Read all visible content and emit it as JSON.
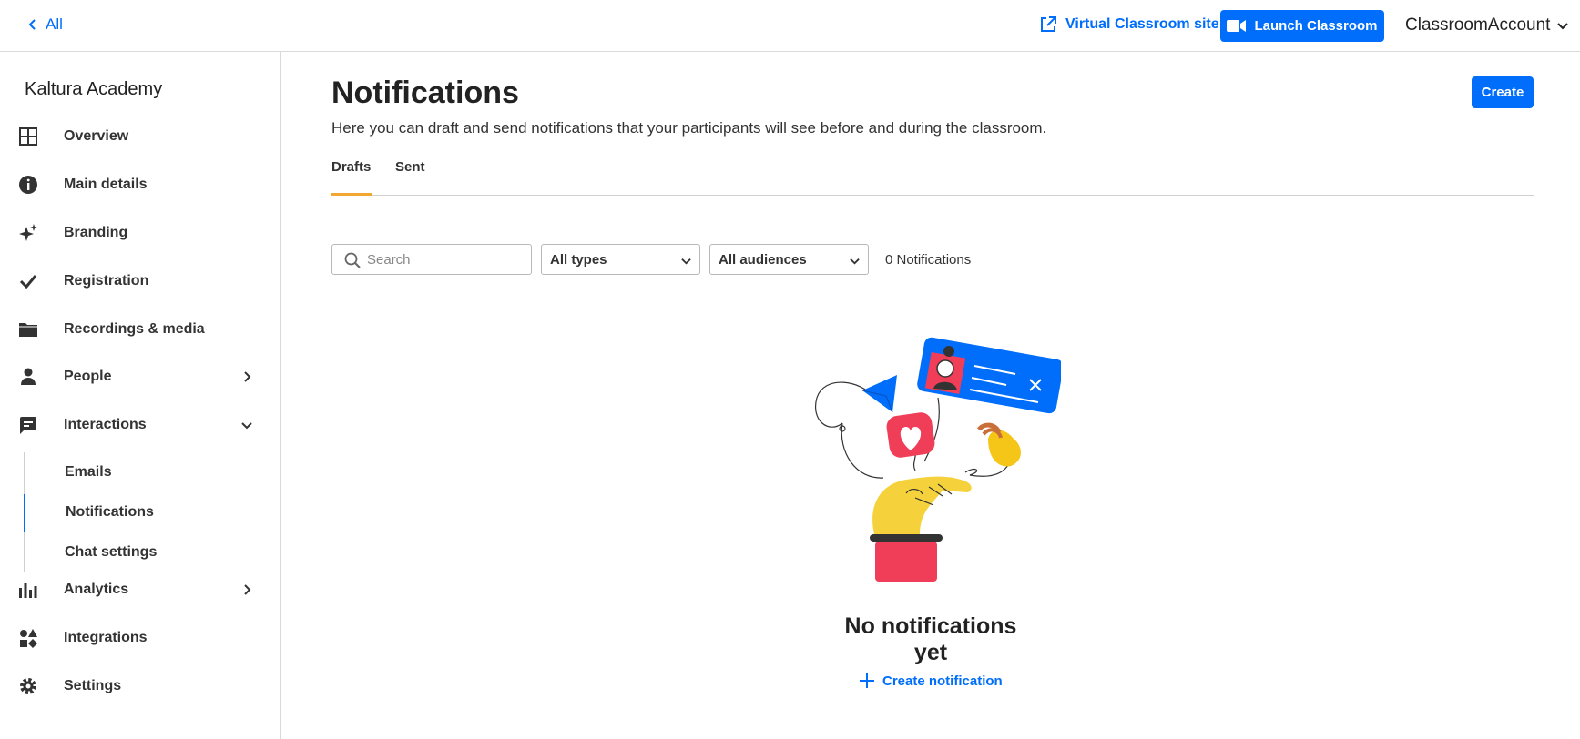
{
  "topbar": {
    "back_label": "All",
    "site_link_label": "Virtual Classroom site",
    "launch_label": "Launch Classroom",
    "account_label": "ClassroomAccount"
  },
  "sidebar": {
    "org_name": "Kaltura Academy",
    "items": [
      {
        "label": "Overview",
        "icon": "grid-icon"
      },
      {
        "label": "Main details",
        "icon": "info-icon"
      },
      {
        "label": "Branding",
        "icon": "sparkle-icon"
      },
      {
        "label": "Registration",
        "icon": "check-icon"
      },
      {
        "label": "Recordings & media",
        "icon": "folder-icon"
      },
      {
        "label": "People",
        "icon": "person-icon"
      },
      {
        "label": "Interactions",
        "icon": "chat-icon"
      },
      {
        "label": "Analytics",
        "icon": "bar-chart-icon"
      },
      {
        "label": "Integrations",
        "icon": "shapes-icon"
      },
      {
        "label": "Settings",
        "icon": "gear-icon"
      }
    ],
    "interactions_sub": [
      {
        "label": "Emails"
      },
      {
        "label": "Notifications",
        "active": true
      },
      {
        "label": "Chat settings"
      }
    ]
  },
  "main": {
    "title": "Notifications",
    "description": "Here you can draft and send notifications that your participants will see before and during the classroom.",
    "create_label": "Create",
    "tabs": [
      {
        "label": "Drafts",
        "active": true
      },
      {
        "label": "Sent",
        "active": false
      }
    ],
    "filters": {
      "search_placeholder": "Search",
      "type_value": "All types",
      "audience_value": "All audiences",
      "count_text": "0 Notifications"
    },
    "empty_state": {
      "title": "No notifications yet",
      "action_label": "Create notification"
    }
  },
  "colors": {
    "accent": "#006efa",
    "tab_underline": "#f0a830"
  }
}
